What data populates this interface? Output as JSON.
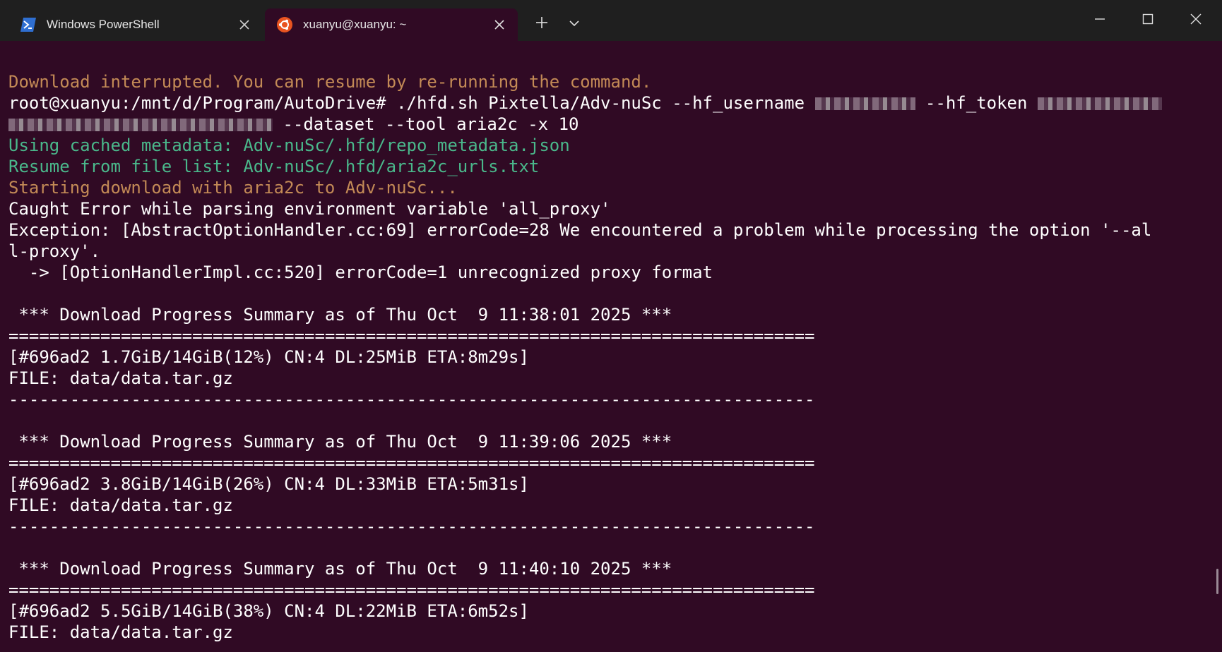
{
  "tabs": [
    {
      "label": "Windows PowerShell",
      "icon": "powershell-icon",
      "active": false
    },
    {
      "label": "xuanyu@xuanyu: ~",
      "icon": "ubuntu-icon",
      "active": true
    }
  ],
  "toolbar": {
    "new_tab_icon": "plus-icon",
    "dropdown_icon": "chevron-down-icon"
  },
  "window_controls": [
    "minimize-icon",
    "maximize-icon",
    "close-icon"
  ],
  "colors": {
    "terminal_bg": "#300a24",
    "titlebar_bg": "#1f1f1f",
    "orange_text": "#c38a56",
    "green_text": "#4ab88b",
    "white_text": "#ffffff"
  },
  "terminal": {
    "l01": "Download interrupted. You can resume by re-running the command.",
    "l02a": "root@xuanyu:/mnt/d/Program/AutoDrive# ./hfd.sh Pixtella/Adv-nuSc --hf_username ",
    "l02b": " --hf_token ",
    "l03": " --dataset --tool aria2c -x 10",
    "l04": "Using cached metadata: Adv-nuSc/.hfd/repo_metadata.json",
    "l05": "Resume from file list: Adv-nuSc/.hfd/aria2c_urls.txt",
    "l06": "Starting download with aria2c to Adv-nuSc...",
    "l07": "Caught Error while parsing environment variable 'all_proxy'",
    "l08": "Exception: [AbstractOptionHandler.cc:69] errorCode=28 We encountered a problem while processing the option '--al",
    "l09": "l-proxy'.",
    "l10": "  -> [OptionHandlerImpl.cc:520] errorCode=1 unrecognized proxy format",
    "l11": "",
    "l12": " *** Download Progress Summary as of Thu Oct  9 11:38:01 2025 ***",
    "l13": "===============================================================================",
    "l14": "[#696ad2 1.7GiB/14GiB(12%) CN:4 DL:25MiB ETA:8m29s]",
    "l15": "FILE: data/data.tar.gz",
    "l16": "-------------------------------------------------------------------------------",
    "l17": "",
    "l18": " *** Download Progress Summary as of Thu Oct  9 11:39:06 2025 ***",
    "l19": "===============================================================================",
    "l20": "[#696ad2 3.8GiB/14GiB(26%) CN:4 DL:33MiB ETA:5m31s]",
    "l21": "FILE: data/data.tar.gz",
    "l22": "-------------------------------------------------------------------------------",
    "l23": "",
    "l24": " *** Download Progress Summary as of Thu Oct  9 11:40:10 2025 ***",
    "l25": "===============================================================================",
    "l26": "[#696ad2 5.5GiB/14GiB(38%) CN:4 DL:22MiB ETA:6m52s]",
    "l27": "FILE: data/data.tar.gz"
  }
}
